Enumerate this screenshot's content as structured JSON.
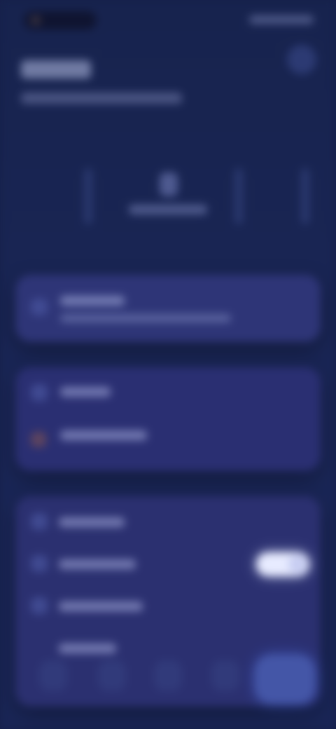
{
  "colors": {
    "background": "#16204a",
    "card": "#2b3070",
    "accent": "#4456a7",
    "toggle_on": "#e7ebff"
  },
  "icons": {
    "dial": "bolt-icon",
    "card1": "bolt-icon",
    "card2_row1": "calendar-icon",
    "card2_row2": "warning-icon",
    "card3_row1": "clock-icon",
    "card3_row2": "moon-icon",
    "card3_row3": "sun-icon"
  },
  "settings": {
    "toggle_on": true
  }
}
